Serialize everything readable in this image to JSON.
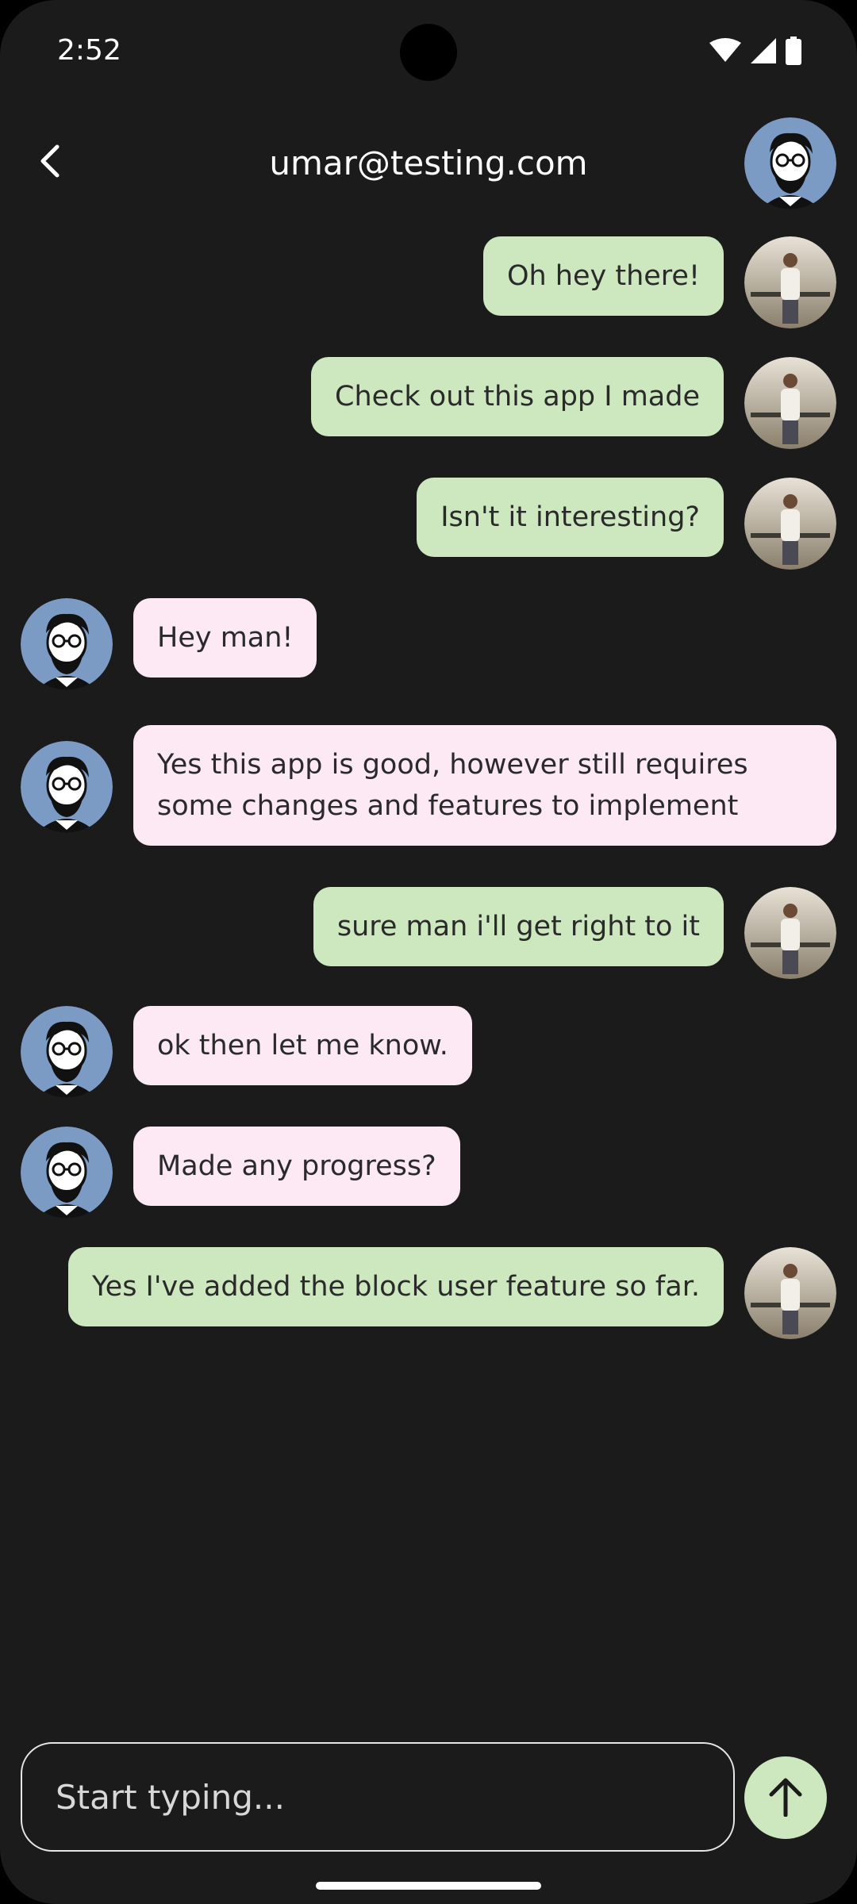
{
  "status_bar": {
    "time": "2:52"
  },
  "header": {
    "title": "umar@testing.com"
  },
  "messages": [
    {
      "type": "sent",
      "text": "Oh hey there!"
    },
    {
      "type": "sent",
      "text": "Check out this app I made"
    },
    {
      "type": "sent",
      "text": "Isn't it interesting?"
    },
    {
      "type": "received",
      "text": "Hey man!"
    },
    {
      "type": "received",
      "text": "Yes this app is good, however still requires some changes and features to implement"
    },
    {
      "type": "sent",
      "text": "sure man i'll get right to it"
    },
    {
      "type": "received",
      "text": "ok then let me know."
    },
    {
      "type": "received",
      "text": "Made any progress?"
    },
    {
      "type": "sent",
      "text": "Yes I've added the block user feature so far."
    }
  ],
  "composer": {
    "placeholder": "Start typing..."
  },
  "colors": {
    "background": "#1b1b1b",
    "sent_bubble": "#cde8bf",
    "received_bubble": "#fde9f4",
    "contact_avatar_bg": "#7b9bc4"
  }
}
